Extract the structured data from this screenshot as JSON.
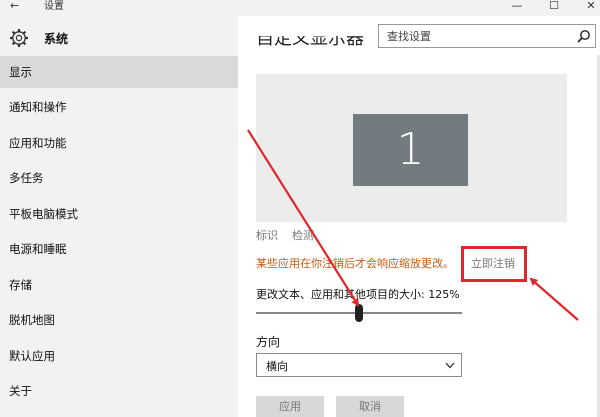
{
  "window": {
    "back_glyph": "←",
    "title": "设置",
    "min_glyph": "—",
    "max_glyph": "☐",
    "close_glyph": "✕"
  },
  "header": {
    "section_title": "系统",
    "search_placeholder": "查找设置"
  },
  "sidebar": {
    "items": [
      {
        "label": "显示",
        "active": true
      },
      {
        "label": "通知和操作"
      },
      {
        "label": "应用和功能"
      },
      {
        "label": "多任务"
      },
      {
        "label": "平板电脑模式"
      },
      {
        "label": "电源和睡眠"
      },
      {
        "label": "存储"
      },
      {
        "label": "脱机地图"
      },
      {
        "label": "默认应用"
      },
      {
        "label": "关于"
      }
    ]
  },
  "main": {
    "page_title": "自定义显示器",
    "monitor_number": "1",
    "identify_label": "标识",
    "detect_label": "检测",
    "warning_text": "某些应用在你注销后才会响应缩放更改。",
    "signout_label": "立即注销",
    "scale_label": "更改文本、应用和其他项目的大小: 125%",
    "scale_level_fraction": 0.5,
    "orientation_label": "方向",
    "orientation_value": "横向",
    "apply_label": "应用",
    "cancel_label": "取消"
  },
  "colors": {
    "sidebar_bg": "#f2f2f2",
    "active_item_bg": "#d9d9d9",
    "monitor_box": "#727c80",
    "warning": "#c55a11",
    "annotation_red": "#e0272b"
  }
}
